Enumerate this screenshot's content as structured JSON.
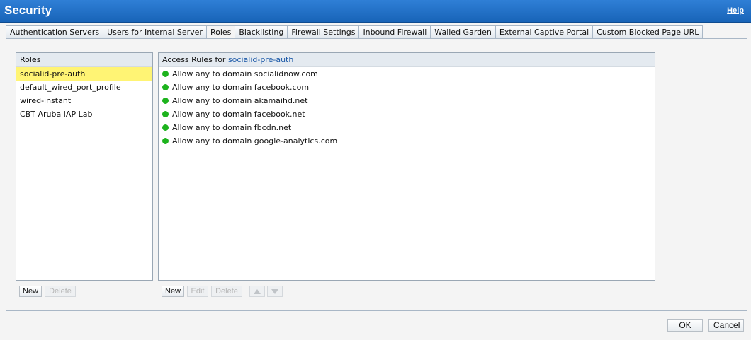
{
  "window": {
    "title": "Security",
    "help_label": "Help"
  },
  "tabs": [
    {
      "label": "Authentication Servers"
    },
    {
      "label": "Users for Internal Server"
    },
    {
      "label": "Roles"
    },
    {
      "label": "Blacklisting"
    },
    {
      "label": "Firewall Settings"
    },
    {
      "label": "Inbound Firewall"
    },
    {
      "label": "Walled Garden"
    },
    {
      "label": "External Captive Portal"
    },
    {
      "label": "Custom Blocked Page URL"
    }
  ],
  "active_tab": "Roles",
  "roles": {
    "header": "Roles",
    "items": [
      {
        "label": "socialid-pre-auth"
      },
      {
        "label": "default_wired_port_profile"
      },
      {
        "label": "wired-instant"
      },
      {
        "label": "CBT Aruba IAP Lab"
      }
    ],
    "selected": "socialid-pre-auth",
    "buttons": {
      "new": "New",
      "delete": "Delete"
    }
  },
  "access_rules": {
    "header_prefix": "Access Rules for",
    "header_role": "socialid-pre-auth",
    "rules": [
      {
        "label": "Allow any to domain socialidnow.com"
      },
      {
        "label": "Allow any to domain facebook.com"
      },
      {
        "label": "Allow any to domain akamaihd.net"
      },
      {
        "label": "Allow any to domain facebook.net"
      },
      {
        "label": "Allow any to domain fbcdn.net"
      },
      {
        "label": "Allow any to domain google-analytics.com"
      }
    ],
    "buttons": {
      "new": "New",
      "edit": "Edit",
      "delete": "Delete"
    }
  },
  "dialog_buttons": {
    "ok": "OK",
    "cancel": "Cancel"
  },
  "colors": {
    "titlebar": "#1864b8",
    "selected_row": "#fff474",
    "allow_dot": "#1db31d",
    "accent_text": "#1d5aa8"
  }
}
